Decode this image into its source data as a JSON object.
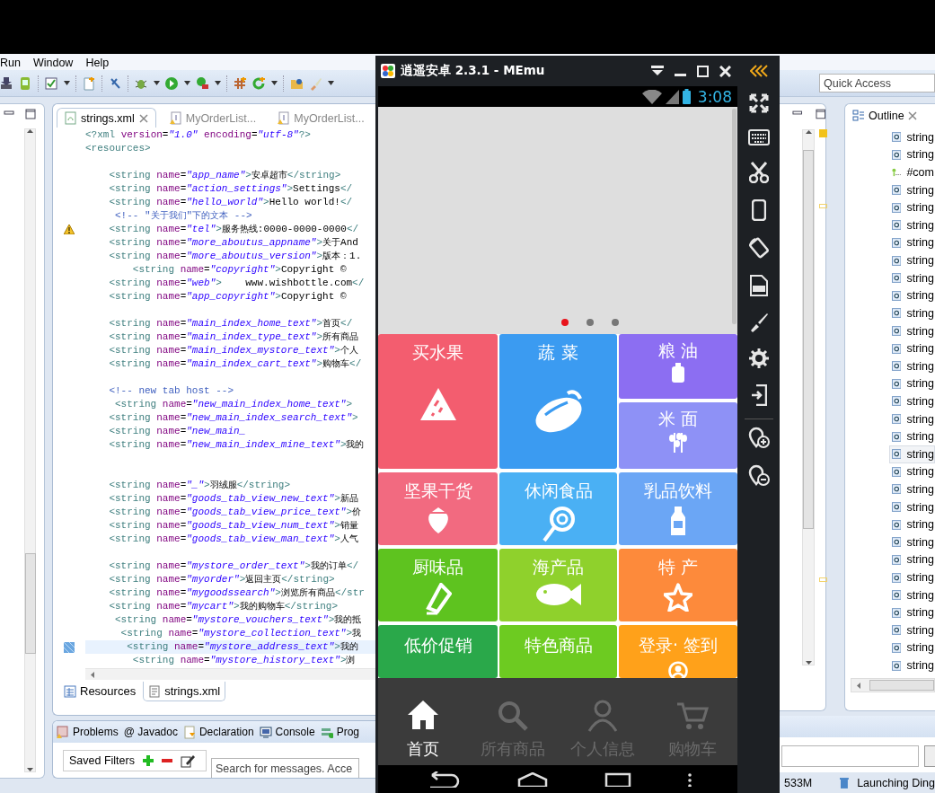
{
  "ide": {
    "menu": [
      "Run",
      "Window",
      "Help"
    ],
    "editor_tabs": [
      {
        "label": "strings.xml",
        "selected": true
      },
      {
        "label": "MyOrderList...",
        "selected": false
      },
      {
        "label": "MyOrderList...",
        "selected": false
      }
    ],
    "code_lines": [
      {
        "kind": "code",
        "text": "<?xml version=\"1.0\" encoding=\"utf-8\"?>",
        "current": false
      },
      {
        "kind": "code",
        "text": "<resources>",
        "current": false
      },
      {
        "kind": "blank"
      },
      {
        "kind": "code",
        "text": "    <string name=\"app_name\">安卓超市</string>",
        "current": false
      },
      {
        "kind": "code",
        "text": "    <string name=\"action_settings\">Settings</",
        "current": false
      },
      {
        "kind": "code",
        "text": "    <string name=\"hello_world\">Hello world!</",
        "current": false
      },
      {
        "kind": "code",
        "text": "     <!-- \"关于我们\"下的文本 -->",
        "current": false
      },
      {
        "kind": "code",
        "text": "    <string name=\"tel\">服务热线:0000-0000-0000</",
        "current": false,
        "marker": {
          "kind": "warning"
        }
      },
      {
        "kind": "code",
        "text": "    <string name=\"more_aboutus_appname\">关于And",
        "current": false
      },
      {
        "kind": "code",
        "text": "    <string name=\"more_aboutus_version\">版本：1.",
        "current": false
      },
      {
        "kind": "code",
        "text": "        <string name=\"copyright\">Copyright ©",
        "current": false
      },
      {
        "kind": "code",
        "text": "    <string name=\"web\">    www.wishbottle.com</",
        "current": false
      },
      {
        "kind": "code",
        "text": "    <string name=\"app_copyright\">Copyright ©",
        "current": false
      },
      {
        "kind": "blank"
      },
      {
        "kind": "code",
        "text": "    <string name=\"main_index_home_text\">首页</",
        "current": false
      },
      {
        "kind": "code",
        "text": "    <string name=\"main_index_type_text\">所有商品",
        "current": false
      },
      {
        "kind": "code",
        "text": "    <string name=\"main_index_mystore_text\">个人",
        "current": false
      },
      {
        "kind": "code",
        "text": "    <string name=\"main_index_cart_text\">购物车</",
        "current": false
      },
      {
        "kind": "blank"
      },
      {
        "kind": "code",
        "text": "    <!-- new tab host -->",
        "current": false
      },
      {
        "kind": "code",
        "text": "     <string name=\"new_main_index_home_text\">",
        "current": false
      },
      {
        "kind": "code",
        "text": "    <string name=\"new_main_index_search_text\">",
        "current": false
      },
      {
        "kind": "code",
        "text": "    <string name=\"new_main_",
        "current": false
      },
      {
        "kind": "code",
        "text": "    <string name=\"new_main_index_mine_text\">我的",
        "current": false
      },
      {
        "kind": "blank"
      },
      {
        "kind": "blank"
      },
      {
        "kind": "code",
        "text": "    <string name=\"_\">羽绒服</string>",
        "current": false
      },
      {
        "kind": "code",
        "text": "    <string name=\"goods_tab_view_new_text\">新品",
        "current": false
      },
      {
        "kind": "code",
        "text": "    <string name=\"goods_tab_view_price_text\">价",
        "current": false
      },
      {
        "kind": "code",
        "text": "    <string name=\"goods_tab_view_num_text\">销量",
        "current": false
      },
      {
        "kind": "code",
        "text": "    <string name=\"goods_tab_view_man_text\">人气",
        "current": false
      },
      {
        "kind": "blank"
      },
      {
        "kind": "code",
        "text": "    <string name=\"mystore_order_text\">我的订单</",
        "current": false
      },
      {
        "kind": "code",
        "text": "    <string name=\"myorder\">返回主页</string>",
        "current": false
      },
      {
        "kind": "code",
        "text": "    <string name=\"mygoodssearch\">浏览所有商品</str",
        "current": false
      },
      {
        "kind": "code",
        "text": "    <string name=\"mycart\">我的购物车</string>",
        "current": false
      },
      {
        "kind": "code",
        "text": "     <string name=\"mystore_vouchers_text\">我的抵",
        "current": false
      },
      {
        "kind": "code",
        "text": "      <string name=\"mystore_collection_text\">我",
        "current": false
      },
      {
        "kind": "code",
        "text": "       <string name=\"mystore_address_text\">我的",
        "current": true,
        "marker": {
          "kind": "bookmark"
        }
      },
      {
        "kind": "code",
        "text": "        <string name=\"mystore_history_text\">浏",
        "current": false
      }
    ],
    "editor_bottom_tabs": [
      {
        "label": "Resources",
        "selected": false
      },
      {
        "label": "strings.xml",
        "selected": true
      }
    ],
    "panel_tabs": [
      "Problems",
      "@ Javadoc",
      "Declaration",
      "Console",
      "Prog"
    ],
    "saved_filters": "Saved Filters",
    "message_search": {
      "placeholder": "Search for messages. Acce"
    },
    "quick_access": {
      "placeholder": "Quick Access"
    },
    "outline": {
      "tab": "Outline",
      "items": [
        {
          "text": "string",
          "kind": "element",
          "selected": false
        },
        {
          "text": "string",
          "kind": "element",
          "selected": false
        },
        {
          "text": "#com",
          "kind": "comment",
          "selected": false
        },
        {
          "text": "string",
          "kind": "element",
          "selected": false
        },
        {
          "text": "string",
          "kind": "element",
          "selected": false
        },
        {
          "text": "string",
          "kind": "element",
          "selected": false
        },
        {
          "text": "string",
          "kind": "element",
          "selected": false
        },
        {
          "text": "string",
          "kind": "element",
          "selected": false
        },
        {
          "text": "string",
          "kind": "element",
          "selected": false
        },
        {
          "text": "string",
          "kind": "element",
          "selected": false
        },
        {
          "text": "string",
          "kind": "element",
          "selected": false
        },
        {
          "text": "string",
          "kind": "element",
          "selected": false
        },
        {
          "text": "string",
          "kind": "element",
          "selected": false
        },
        {
          "text": "string",
          "kind": "element",
          "selected": false
        },
        {
          "text": "string",
          "kind": "element",
          "selected": false
        },
        {
          "text": "string",
          "kind": "element",
          "selected": false
        },
        {
          "text": "string",
          "kind": "element",
          "selected": false
        },
        {
          "text": "string",
          "kind": "element",
          "selected": false
        },
        {
          "text": "string",
          "kind": "element",
          "selected": true
        },
        {
          "text": "string",
          "kind": "element",
          "selected": false
        },
        {
          "text": "string",
          "kind": "element",
          "selected": false
        },
        {
          "text": "string",
          "kind": "element",
          "selected": false
        },
        {
          "text": "string",
          "kind": "element",
          "selected": false
        },
        {
          "text": "string",
          "kind": "element",
          "selected": false
        },
        {
          "text": "string",
          "kind": "element",
          "selected": false
        },
        {
          "text": "string",
          "kind": "element",
          "selected": false
        },
        {
          "text": "string",
          "kind": "element",
          "selected": false
        },
        {
          "text": "string",
          "kind": "element",
          "selected": false
        },
        {
          "text": "string",
          "kind": "element",
          "selected": false
        },
        {
          "text": "string",
          "kind": "element",
          "selected": false
        },
        {
          "text": "string",
          "kind": "element",
          "selected": false
        }
      ]
    },
    "status": {
      "memory": "533M",
      "job": "Launching Ding"
    }
  },
  "emulator": {
    "title": "逍遥安卓 2.3.1 - MEmu",
    "clock": "3:08",
    "banner_dots": [
      {
        "selected": true
      },
      {
        "selected": false
      },
      {
        "selected": false
      }
    ],
    "tiles": [
      {
        "label": "买水果",
        "color": "#f35d6f"
      },
      {
        "label": "蔬 菜",
        "color": "#3b9bf1"
      },
      {
        "label": "粮 油",
        "color": "#8c6ef2"
      },
      {
        "label": "米 面",
        "color": "#8e91f6"
      },
      {
        "label": "坚果干货",
        "color": "#f26a80"
      },
      {
        "label": "休闲食品",
        "color": "#4ab0f4"
      },
      {
        "label": "乳品饮料",
        "color": "#6ba6f5"
      },
      {
        "label": "厨味品",
        "color": "#5ec31f"
      },
      {
        "label": "海产品",
        "color": "#8fd12c"
      },
      {
        "label": "特 产",
        "color": "#fd8a3b"
      },
      {
        "label": "低价促销",
        "color": "#2aa84a"
      },
      {
        "label": "特色商品",
        "color": "#6dcb21"
      },
      {
        "label": "登录· 签到",
        "color": "#ffa11a"
      }
    ],
    "tabs": [
      {
        "label": "首页",
        "selected": true
      },
      {
        "label": "所有商品",
        "selected": false
      },
      {
        "label": "个人信息",
        "selected": false
      },
      {
        "label": "购物车",
        "selected": false
      }
    ]
  }
}
